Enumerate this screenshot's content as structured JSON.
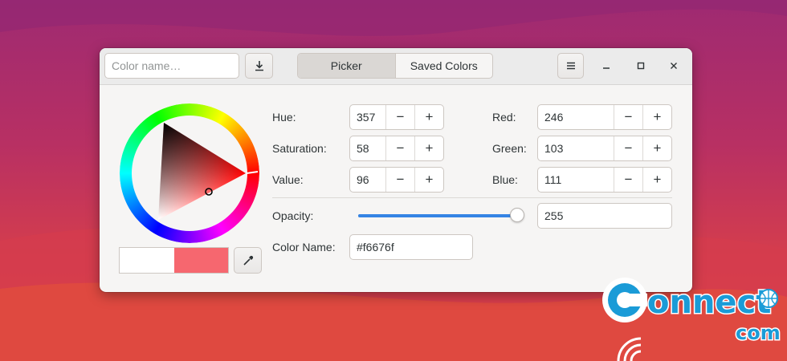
{
  "toolbar": {
    "color_name_placeholder": "Color name…",
    "download_icon": "download-icon",
    "menu_icon": "hamburger-menu-icon"
  },
  "tabs": [
    {
      "label": "Picker",
      "active": true
    },
    {
      "label": "Saved Colors",
      "active": false
    }
  ],
  "window_controls": {
    "minimize_icon": "minimize-icon",
    "maximize_icon": "maximize-icon",
    "close_icon": "close-icon"
  },
  "hsv": {
    "hue": {
      "label": "Hue:",
      "value": "357"
    },
    "saturation": {
      "label": "Saturation:",
      "value": "58"
    },
    "value": {
      "label": "Value:",
      "value": "96"
    }
  },
  "rgb": {
    "red": {
      "label": "Red:",
      "value": "246"
    },
    "green": {
      "label": "Green:",
      "value": "103"
    },
    "blue": {
      "label": "Blue:",
      "value": "111"
    }
  },
  "spin": {
    "decrement": "−",
    "increment": "+"
  },
  "opacity": {
    "label": "Opacity:",
    "value": "255",
    "fraction": 1.0
  },
  "color_name": {
    "label": "Color Name:",
    "value": "#f6676f"
  },
  "swatches": {
    "previous": "#ffffff",
    "current": "#f6676f"
  },
  "eyedropper_icon": "eyedropper-icon",
  "colors": {
    "accent": "#3584e4",
    "selected": "#f6676f"
  },
  "watermark": {
    "word": "onnect",
    "suffix": "com"
  }
}
